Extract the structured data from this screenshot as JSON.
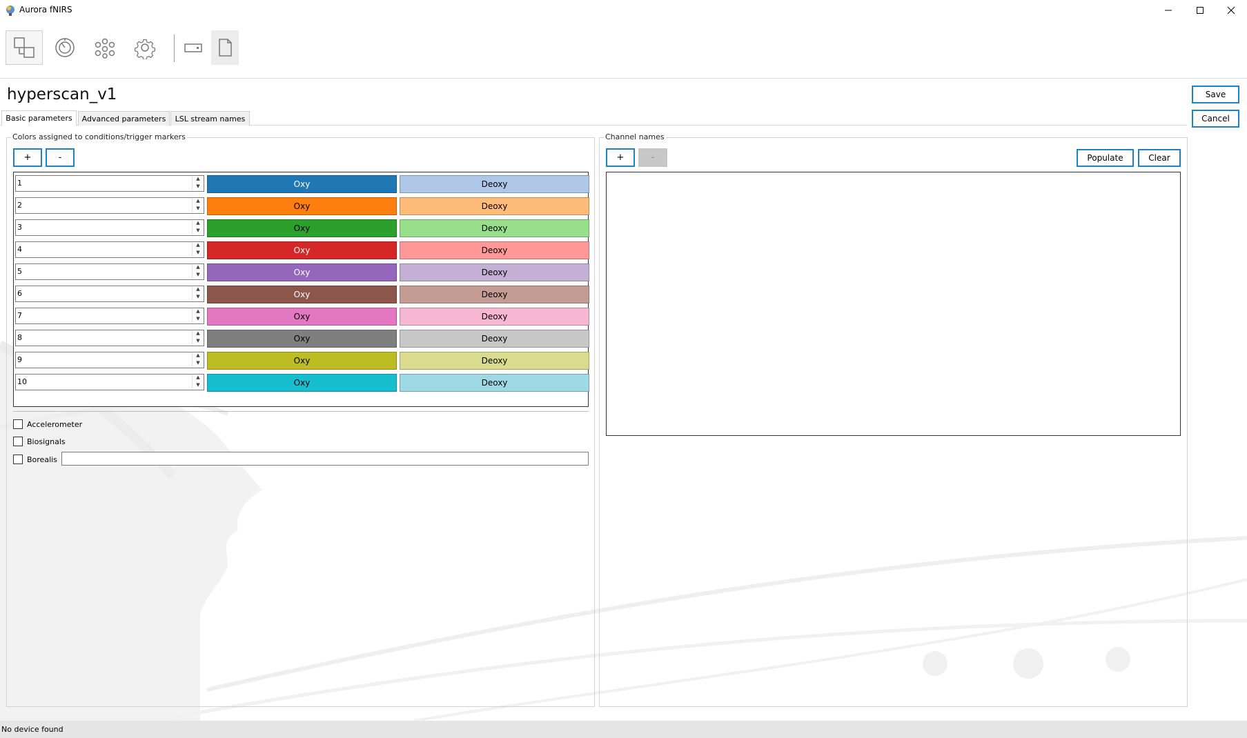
{
  "window": {
    "title": "Aurora fNIRS",
    "controls": [
      "minimize-icon",
      "maximize-icon",
      "close-icon"
    ]
  },
  "toolbar": {
    "buttons": [
      {
        "name": "layout-icon",
        "selected": true
      },
      {
        "name": "speedometer-icon",
        "selected": false
      },
      {
        "name": "network-icon",
        "selected": false
      },
      {
        "name": "gear-icon",
        "selected": false
      },
      {
        "name": "device-icon",
        "selected": false
      },
      {
        "name": "document-icon",
        "selected": false,
        "hover": true
      }
    ]
  },
  "page": {
    "title": "hyperscan_v1",
    "save_label": "Save",
    "cancel_label": "Cancel"
  },
  "tabs": [
    {
      "label": "Basic parameters",
      "active": true
    },
    {
      "label": "Advanced parameters",
      "active": false
    },
    {
      "label": "LSL stream names",
      "active": false
    }
  ],
  "colors_panel": {
    "label": "Colors assigned to conditions/trigger markers",
    "add_label": "+",
    "remove_label": "-",
    "rows": [
      {
        "id": "1",
        "oxy_label": "Oxy",
        "oxy_color": "#1f77b4",
        "oxy_text": "#ffffff",
        "deoxy_label": "Deoxy",
        "deoxy_color": "#aec7e8",
        "deoxy_text": "#000000"
      },
      {
        "id": "2",
        "oxy_label": "Oxy",
        "oxy_color": "#ff7f0e",
        "oxy_text": "#000000",
        "deoxy_label": "Deoxy",
        "deoxy_color": "#ffbb78",
        "deoxy_text": "#000000"
      },
      {
        "id": "3",
        "oxy_label": "Oxy",
        "oxy_color": "#2ca02c",
        "oxy_text": "#000000",
        "deoxy_label": "Deoxy",
        "deoxy_color": "#98df8a",
        "deoxy_text": "#000000"
      },
      {
        "id": "4",
        "oxy_label": "Oxy",
        "oxy_color": "#d62728",
        "oxy_text": "#ffffff",
        "deoxy_label": "Deoxy",
        "deoxy_color": "#ff9896",
        "deoxy_text": "#000000"
      },
      {
        "id": "5",
        "oxy_label": "Oxy",
        "oxy_color": "#9467bd",
        "oxy_text": "#ffffff",
        "deoxy_label": "Deoxy",
        "deoxy_color": "#c5b0d5",
        "deoxy_text": "#000000"
      },
      {
        "id": "6",
        "oxy_label": "Oxy",
        "oxy_color": "#8c564b",
        "oxy_text": "#ffffff",
        "deoxy_label": "Deoxy",
        "deoxy_color": "#c49c94",
        "deoxy_text": "#000000"
      },
      {
        "id": "7",
        "oxy_label": "Oxy",
        "oxy_color": "#e377c2",
        "oxy_text": "#000000",
        "deoxy_label": "Deoxy",
        "deoxy_color": "#f7b6d2",
        "deoxy_text": "#000000"
      },
      {
        "id": "8",
        "oxy_label": "Oxy",
        "oxy_color": "#7f7f7f",
        "oxy_text": "#000000",
        "deoxy_label": "Deoxy",
        "deoxy_color": "#c7c7c7",
        "deoxy_text": "#000000"
      },
      {
        "id": "9",
        "oxy_label": "Oxy",
        "oxy_color": "#bcbd22",
        "oxy_text": "#000000",
        "deoxy_label": "Deoxy",
        "deoxy_color": "#dbdb8d",
        "deoxy_text": "#000000"
      },
      {
        "id": "10",
        "oxy_label": "Oxy",
        "oxy_color": "#17becf",
        "oxy_text": "#000000",
        "deoxy_label": "Deoxy",
        "deoxy_color": "#9edae5",
        "deoxy_text": "#000000"
      }
    ],
    "options": [
      {
        "label": "Accelerometer",
        "checked": false
      },
      {
        "label": "Biosignals",
        "checked": false
      },
      {
        "label": "Borealis",
        "checked": false,
        "value": ""
      }
    ]
  },
  "channel_panel": {
    "label": "Channel names",
    "add_label": "+",
    "remove_label": "-",
    "populate_label": "Populate",
    "clear_label": "Clear"
  },
  "status": {
    "text": "No device found"
  },
  "accent_color": "#1a82c8"
}
